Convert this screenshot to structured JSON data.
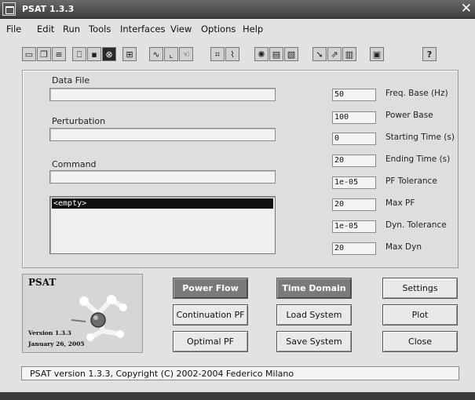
{
  "window": {
    "title": "PSAT 1.3.3"
  },
  "menu": [
    "File",
    "Edit",
    "Run",
    "Tools",
    "Interfaces",
    "View",
    "Options",
    "Help"
  ],
  "toolbar_icons": [
    "open-folder-icon",
    "copy-icon",
    "file-icon",
    "preview-icon",
    "save-disk-icon",
    "close-circle-icon",
    "report-icon",
    "sine-wave-icon",
    "chart-icon",
    "hand-icon",
    "network-icon",
    "plot-icon",
    "gear-circle-icon",
    "document-icon",
    "image-icon",
    "arrow-icon",
    "signal-icon",
    "bars-icon",
    "book-icon"
  ],
  "toolbar_help": "?",
  "fields": {
    "data_file": {
      "label": "Data File",
      "value": ""
    },
    "perturbation": {
      "label": "Perturbation",
      "value": ""
    },
    "command": {
      "label": "Command",
      "value": ""
    }
  },
  "listbox": {
    "selected": "<empty>"
  },
  "params": [
    {
      "value": "50",
      "label": "Freq. Base (Hz)"
    },
    {
      "value": "100",
      "label": "Power Base"
    },
    {
      "value": "0",
      "label": "Starting Time (s)"
    },
    {
      "value": "20",
      "label": "Ending Time (s)"
    },
    {
      "value": "1e-05",
      "label": "PF Tolerance"
    },
    {
      "value": "20",
      "label": "Max PF"
    },
    {
      "value": "1e-05",
      "label": "Dyn. Tolerance"
    },
    {
      "value": "20",
      "label": "Max Dyn"
    }
  ],
  "logo": {
    "title": "PSAT",
    "version": "Version 1.3.3",
    "date": "January 26,  2005"
  },
  "buttons": {
    "power_flow": "Power Flow",
    "time_domain": "Time Domain",
    "settings": "Settings",
    "continuation_pf": "Continuation PF",
    "load_system": "Load System",
    "plot": "Plot",
    "optimal_pf": "Optimal PF",
    "save_system": "Save System",
    "close": "Close"
  },
  "status": "PSAT version 1.3.3, Copyright (C) 2002-2004 Federico Milano"
}
